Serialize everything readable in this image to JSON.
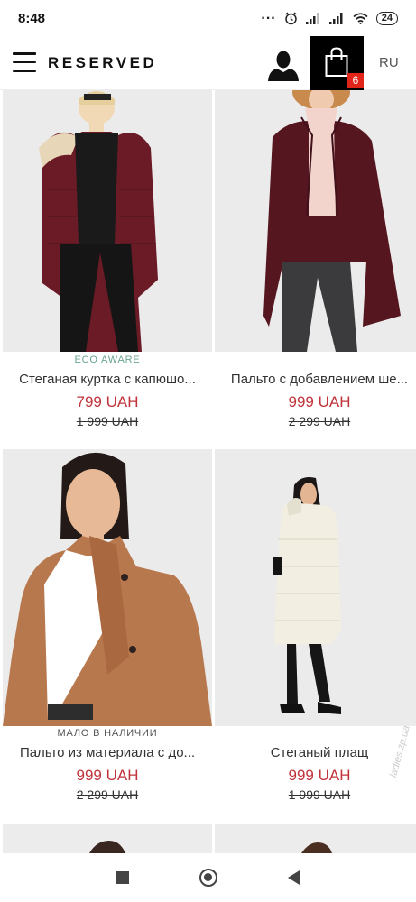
{
  "status_bar": {
    "time": "8:48",
    "battery": "24"
  },
  "header": {
    "logo": "RESERVED",
    "cart_count": "6",
    "language": "RU"
  },
  "products": [
    {
      "tag": "ECO AWARE",
      "name": "Стеганая куртка с капюшо...",
      "price": "799 UAH",
      "old_price": "1 999 UAH"
    },
    {
      "tag": "",
      "name": "Пальто с добавлением ше...",
      "price": "999 UAH",
      "old_price": "2 299 UAH"
    },
    {
      "tag": "МАЛО В НАЛИЧИИ",
      "name": "Пальто из материала с до...",
      "price": "999 UAH",
      "old_price": "2 299 UAH"
    },
    {
      "tag": "",
      "name": "Стеганый плащ",
      "price": "999 UAH",
      "old_price": "1 999 UAH"
    }
  ],
  "colors": {
    "price": "#c0333a",
    "eco_tag": "#68a48e",
    "cart_badge": "#e1251b"
  },
  "watermark": "ladies.zp.ua"
}
